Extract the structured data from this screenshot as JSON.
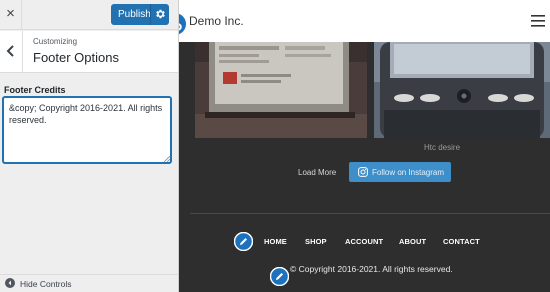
{
  "customizer": {
    "close_glyph": "×",
    "publish_label": "Publish",
    "breadcrumb": "Customizing",
    "section_title": "Footer Options",
    "footer_credits_label": "Footer Credits",
    "footer_credits_value": "&copy; Copyright 2016-2021. All rights reserved.",
    "hide_controls_label": "Hide Controls",
    "accent_color": "#2271b1"
  },
  "site": {
    "title": "Demo Inc.",
    "photo_caption": "Htc desire",
    "load_more_label": "Load More",
    "follow_label": "Follow on Instagram",
    "follow_color": "#3e8ec9",
    "footer_nav": [
      {
        "label": "HOME"
      },
      {
        "label": "SHOP"
      },
      {
        "label": "ACCOUNT"
      },
      {
        "label": "ABOUT"
      },
      {
        "label": "CONTACT"
      }
    ],
    "copyright": "© Copyright 2016-2021. All rights reserved.",
    "edit_shortcut_color": "#1e72bd"
  },
  "icons": [
    "close-icon",
    "gear-icon",
    "back-chevron-icon",
    "hide-controls-icon",
    "site-logo-icon",
    "hamburger-menu-icon",
    "instagram-icon",
    "edit-pencil-icon"
  ]
}
